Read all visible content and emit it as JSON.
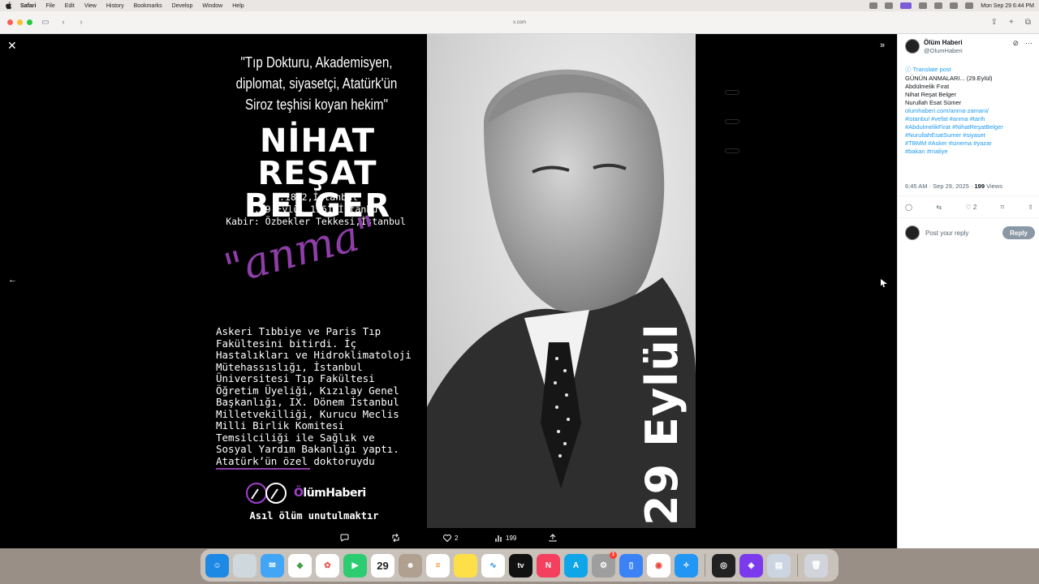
{
  "menubar": {
    "app": "Safari",
    "items": [
      "File",
      "Edit",
      "View",
      "History",
      "Bookmarks",
      "Develop",
      "Window",
      "Help"
    ],
    "clock": "Mon Sep 29  6:44 PM"
  },
  "toolbar": {
    "url": "x.com"
  },
  "poster": {
    "quote": "\"Tıp Dokturu, Akademisyen, diplomat, siyasetçi, Atatürk'ün Siroz teşhisi koyan hekim\"",
    "name_line1": "NİHAT REŞAT",
    "name_line2": "BELGER",
    "born": "d.1882,İstanbul",
    "died": "ö.29 Eylül 1961,İstanbul",
    "grave": "Kabir: Özbekler Tekkesi,İstanbul",
    "anma": "\"anma\"",
    "story": "Askeri Tıbbiye ve Paris Tıp\nFakültesini bitirdi. İç\nHastalıkları ve Hidroklimatoloji\nMütehassıslığı, İstanbul\nÜniversitesi Tıp Fakültesi\nÖğretim Üyeliği, Kızılay Genel\nBaşkanlığı, IX. Dönem İstanbul\nMilletvekilliği, Kurucu Meclis\nMilli Birlik Komitesi\nTemsilciliği ile Sağlık ve\nSosyal Yardım Bakanlığı yaptı.\nAtatürk’ün özel doktoruydu",
    "brand_prefix": "Ö",
    "brand_rest": "lümHaberi",
    "slogan": "Asıl ölüm unutulmaktır",
    "date_vertical": "29 Eylül"
  },
  "viewer_actions": {
    "likes": "2",
    "views": "199"
  },
  "panel": {
    "name": "Ölüm Haberi",
    "handle": "@OlumHaberi",
    "translate": "Translate post",
    "text_lines": [
      {
        "t": "GÜNÜN ANMALARI... (29.Eylül)",
        "link": false
      },
      {
        "t": "Abdülmelik Fırat",
        "link": false
      },
      {
        "t": "Nihat Reşat Belger",
        "link": false
      },
      {
        "t": "Nurullah Esat Sümer",
        "link": false
      },
      {
        "t": "olumhaberi.com/anma-zamani/",
        "link": true
      },
      {
        "t": "#istanbul #vefat #anma #tarih",
        "link": true
      },
      {
        "t": "#AbdulmelikFirat #NihatReşatBelger",
        "link": true
      },
      {
        "t": "#NurullahEsatSumer #siyaset",
        "link": true
      },
      {
        "t": "#TBMM #Asker #sinema #yazar",
        "link": true
      },
      {
        "t": "#bakan #maliye",
        "link": true
      }
    ],
    "time": "6:45 AM · Sep 29, 2025 · ",
    "views_count": "199",
    "views_label": " Views",
    "likes": "2",
    "reply_placeholder": "Post your reply",
    "reply_button": "Reply"
  },
  "dock": {
    "calendar_day": "29",
    "tv_label": "tv",
    "badge": "1"
  }
}
